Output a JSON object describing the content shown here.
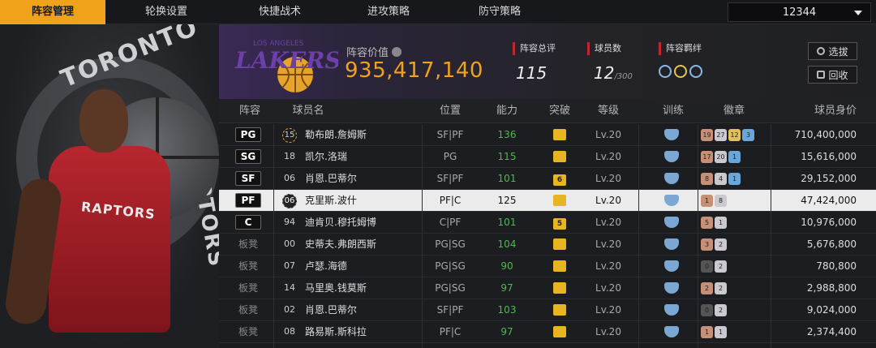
{
  "nav": {
    "tabs": [
      "阵容管理",
      "轮换设置",
      "快捷战术",
      "进攻策略",
      "防守策略"
    ],
    "active_tab": 0,
    "dropdown_value": "12344"
  },
  "art": {
    "team_word_1": "TORONTO",
    "team_word_2": "RAPTORS",
    "jersey_text": "RAPTORS"
  },
  "team": {
    "logo_text": "LAKERS",
    "logo_subtext": "LOS ANGELES",
    "value_label": "阵容价值",
    "value": "935,417,140",
    "rating_label": "阵容总评",
    "rating": "115",
    "count_label": "球员数",
    "count": "12",
    "count_max": "/300",
    "bond_label": "阵容羁绊",
    "select_btn": "选拔",
    "recycle_btn": "回收"
  },
  "table": {
    "headers": [
      "阵容",
      "球员名",
      "位置",
      "能力",
      "突破",
      "等级",
      "训练",
      "徽章",
      "球员身价"
    ],
    "rows": [
      {
        "pos": "PG",
        "num": "15",
        "name": "勒布朗.詹姆斯",
        "position": "SF|PF",
        "ability": "136",
        "breakthrough": "",
        "level": "Lv.20",
        "badges": [
          [
            "19",
            "br"
          ],
          [
            "27",
            "sv"
          ],
          [
            "12",
            "gd"
          ],
          [
            "3",
            "bl"
          ]
        ],
        "salary": "710,400,000",
        "starter": true,
        "selected": false
      },
      {
        "pos": "SG",
        "num": "18",
        "name": "凯尔.洛瑞",
        "position": "PG",
        "ability": "115",
        "breakthrough": "",
        "level": "Lv.20",
        "badges": [
          [
            "17",
            "br"
          ],
          [
            "20",
            "sv"
          ],
          [
            "1",
            "bl"
          ]
        ],
        "salary": "15,616,000",
        "starter": true,
        "selected": false
      },
      {
        "pos": "SF",
        "num": "06",
        "name": "肖恩.巴蒂尔",
        "position": "SF|PF",
        "ability": "101",
        "breakthrough": "6",
        "level": "Lv.20",
        "badges": [
          [
            "8",
            "br"
          ],
          [
            "4",
            "sv"
          ],
          [
            "1",
            "bl"
          ]
        ],
        "salary": "29,152,000",
        "starter": true,
        "selected": false
      },
      {
        "pos": "PF",
        "num": "06",
        "name": "克里斯.波什",
        "position": "PF|C",
        "ability": "125",
        "breakthrough": "",
        "level": "Lv.20",
        "badges": [
          [
            "1",
            "br"
          ],
          [
            "8",
            "sv"
          ]
        ],
        "salary": "47,424,000",
        "starter": true,
        "selected": true
      },
      {
        "pos": "C",
        "num": "94",
        "name": "迪肯贝.穆托姆博",
        "position": "C|PF",
        "ability": "101",
        "breakthrough": "5",
        "level": "Lv.20",
        "badges": [
          [
            "5",
            "br"
          ],
          [
            "1",
            "sv"
          ]
        ],
        "salary": "10,976,000",
        "starter": true,
        "selected": false
      },
      {
        "pos": "板凳",
        "num": "00",
        "name": "史蒂夫.弗朗西斯",
        "position": "PG|SG",
        "ability": "104",
        "breakthrough": "",
        "level": "Lv.20",
        "badges": [
          [
            "3",
            "br"
          ],
          [
            "2",
            "sv"
          ]
        ],
        "salary": "5,676,800",
        "starter": false,
        "selected": false
      },
      {
        "pos": "板凳",
        "num": "07",
        "name": "卢瑟.海德",
        "position": "PG|SG",
        "ability": "90",
        "breakthrough": "",
        "level": "Lv.20",
        "badges": [
          [
            "0",
            "dk"
          ],
          [
            "2",
            "sv"
          ]
        ],
        "salary": "780,800",
        "starter": false,
        "selected": false
      },
      {
        "pos": "板凳",
        "num": "14",
        "name": "马里奥.钱莫斯",
        "position": "PG|SG",
        "ability": "97",
        "breakthrough": "",
        "level": "Lv.20",
        "badges": [
          [
            "2",
            "br"
          ],
          [
            "2",
            "sv"
          ]
        ],
        "salary": "2,988,800",
        "starter": false,
        "selected": false
      },
      {
        "pos": "板凳",
        "num": "02",
        "name": "肖恩.巴蒂尔",
        "position": "SF|PF",
        "ability": "103",
        "breakthrough": "",
        "level": "Lv.20",
        "badges": [
          [
            "0",
            "dk"
          ],
          [
            "2",
            "sv"
          ]
        ],
        "salary": "9,024,000",
        "starter": false,
        "selected": false
      },
      {
        "pos": "板凳",
        "num": "08",
        "name": "路易斯.斯科拉",
        "position": "PF|C",
        "ability": "97",
        "breakthrough": "",
        "level": "Lv.20",
        "badges": [
          [
            "1",
            "br"
          ],
          [
            "1",
            "sv"
          ]
        ],
        "salary": "2,374,400",
        "starter": false,
        "selected": false
      }
    ]
  },
  "colors": {
    "accent": "#f0a21a",
    "value": "#f0a21a",
    "ability": "#4fb84f",
    "stat_marker": "#c0282d"
  }
}
